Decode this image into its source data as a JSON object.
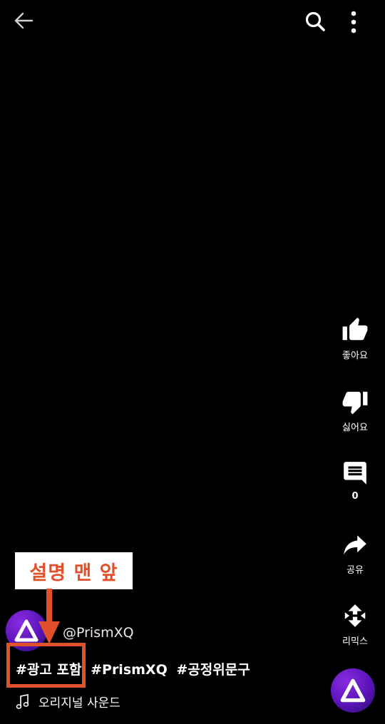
{
  "top_bar": {
    "icons": [
      "arrow-left-icon",
      "search-icon",
      "more-vertical-icon"
    ]
  },
  "actions": {
    "like_label": "좋아요",
    "dislike_label": "싫어요",
    "comment_count": "0",
    "share_label": "공유",
    "remix_label": "리믹스"
  },
  "channel": {
    "handle": "@PrismXQ"
  },
  "description": {
    "hashtags": [
      "#광고 포함",
      "#PrismXQ",
      "#공정위문구"
    ]
  },
  "sound": {
    "label": "오리지널 사운드"
  },
  "annotation": {
    "label": "설명 맨 앞",
    "color": "#e0502a"
  }
}
